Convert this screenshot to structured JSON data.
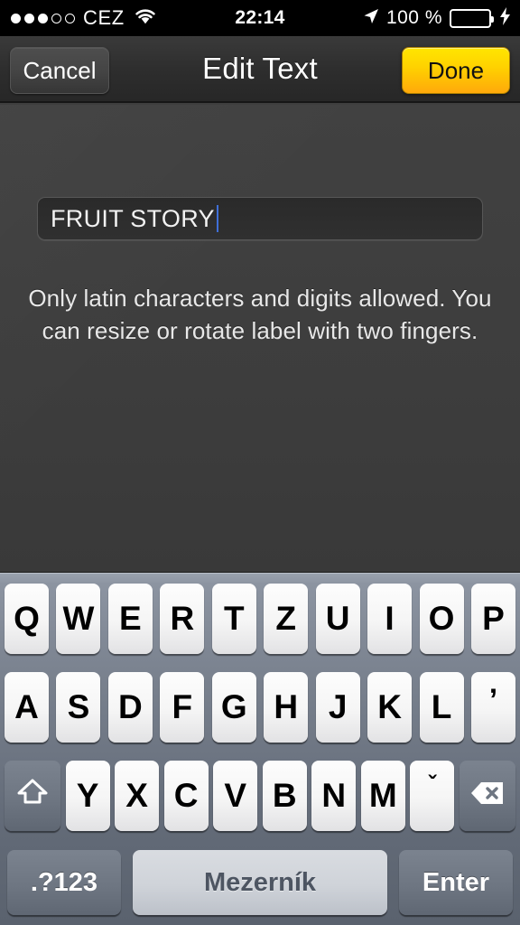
{
  "status_bar": {
    "signal_dots_filled": 3,
    "signal_dots_total": 5,
    "carrier": "CEZ",
    "wifi_icon": "wifi-icon",
    "time": "22:14",
    "location_icon": "location-arrow-icon",
    "battery_percent": "100 %",
    "battery_level": 100,
    "battery_color": "#4cd964",
    "charging_icon": "lightning-bolt-icon"
  },
  "nav_bar": {
    "cancel_label": "Cancel",
    "title": "Edit Text",
    "done_label": "Done",
    "done_color": "#ffd000"
  },
  "content": {
    "text_field_value": "FRUIT STORY",
    "caret_color": "#3f6fd8",
    "hint_text": "Only latin characters and digits allowed. You can resize or rotate label with two fingers."
  },
  "keyboard": {
    "layout": "QWERTZ",
    "row1": [
      "Q",
      "W",
      "E",
      "R",
      "T",
      "Z",
      "U",
      "I",
      "O",
      "P"
    ],
    "row2": [
      "A",
      "S",
      "D",
      "F",
      "G",
      "H",
      "J",
      "K",
      "L",
      "’"
    ],
    "row3_shift_icon": "shift-up-arrow-icon",
    "row3": [
      "Y",
      "X",
      "C",
      "V",
      "B",
      "N",
      "M",
      "ˇ"
    ],
    "row3_backspace_icon": "backspace-delete-icon",
    "row4": {
      "numbers_label": ".?123",
      "space_label": "Mezerník",
      "enter_label": "Enter"
    }
  }
}
